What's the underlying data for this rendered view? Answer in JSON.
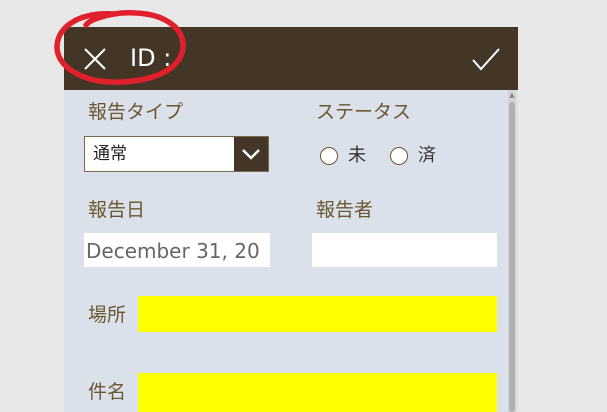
{
  "header": {
    "title": "ID :",
    "close_icon": "close-icon",
    "confirm_icon": "check-icon"
  },
  "form": {
    "report_type": {
      "label": "報告タイプ",
      "value": "通常"
    },
    "status": {
      "label": "ステータス",
      "options": [
        "未",
        "済"
      ]
    },
    "report_date": {
      "label": "報告日",
      "value": "December 31, 20"
    },
    "reporter": {
      "label": "報告者",
      "value": ""
    },
    "location": {
      "label": "場所",
      "value": ""
    },
    "subject": {
      "label": "件名",
      "value": ""
    }
  },
  "colors": {
    "header_bg": "#433626",
    "form_bg": "#dae1ea",
    "label": "#6b5730",
    "highlight": "#ffff00",
    "annotation": "#e0202a"
  }
}
